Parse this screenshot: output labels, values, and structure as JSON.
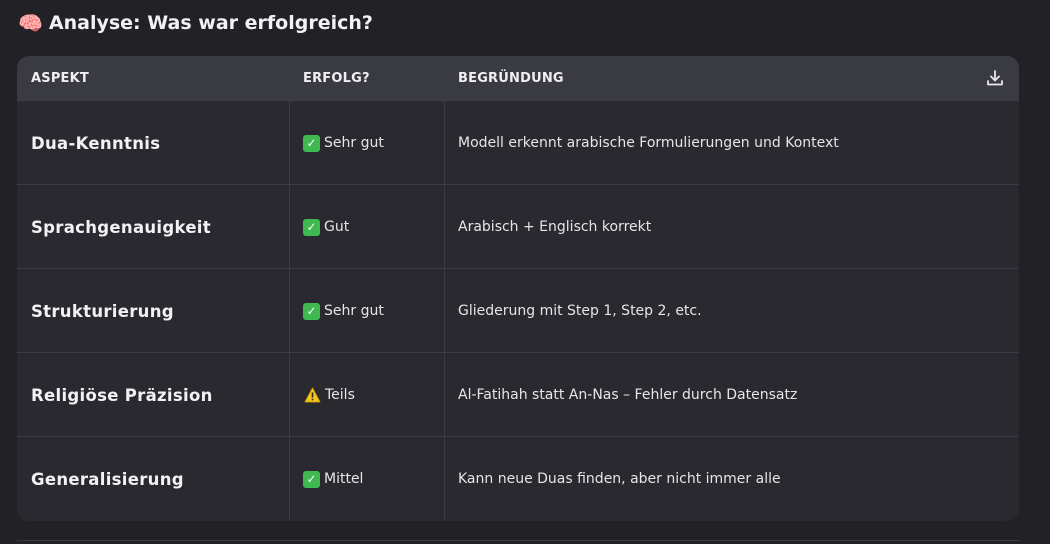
{
  "heading": {
    "icon": "brain-icon",
    "text": "Analyse: Was war erfolgreich?"
  },
  "table": {
    "headers": [
      "ASPEKT",
      "ERFOLG?",
      "BEGRÜNDUNG"
    ],
    "download_icon": "download-icon",
    "rows": [
      {
        "aspect": "Dua-Kenntnis",
        "status_icon": "check-icon",
        "status": "Sehr gut",
        "reason": "Modell erkennt arabische Formulierungen und Kontext"
      },
      {
        "aspect": "Sprachgenauigkeit",
        "status_icon": "check-icon",
        "status": "Gut",
        "reason": "Arabisch + Englisch korrekt"
      },
      {
        "aspect": "Strukturierung",
        "status_icon": "check-icon",
        "status": "Sehr gut",
        "reason": "Gliederung mit Step 1, Step 2, etc."
      },
      {
        "aspect": "Religiöse Präzision",
        "status_icon": "warning-icon",
        "status": "Teils",
        "reason": "Al-Fatihah statt An-Nas – Fehler durch Datensatz"
      },
      {
        "aspect": "Generalisierung",
        "status_icon": "check-icon",
        "status": "Mittel",
        "reason": "Kann neue Duas finden, aber nicht immer alle"
      }
    ]
  },
  "colors": {
    "background": "#212126",
    "table_bg": "#29292f",
    "header_bg": "#3a3a42",
    "check_green": "#3fb950",
    "warning_yellow": "#f5c518"
  }
}
